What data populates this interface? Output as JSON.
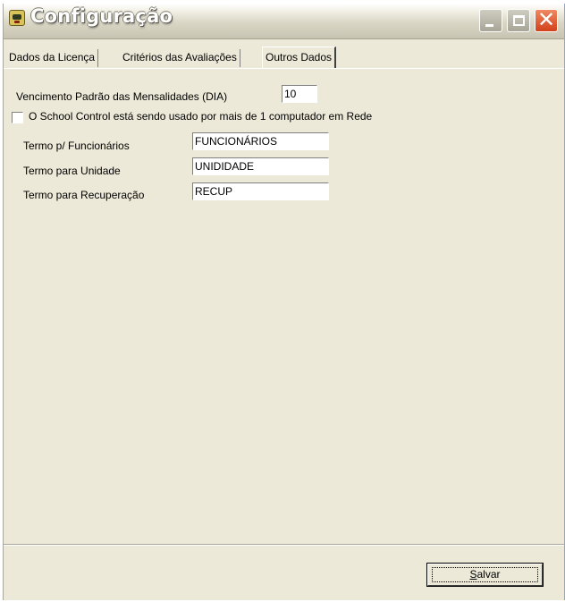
{
  "window": {
    "title": "Configuração",
    "icon": "app-icon",
    "controls": {
      "minimize": "minimize-icon",
      "maximize": "maximize-icon",
      "close": "close-icon",
      "close_glyph": "✕"
    }
  },
  "tabs": [
    {
      "label": "Dados da Licença"
    },
    {
      "label": "Critérios das Avaliações"
    },
    {
      "label": "Outros Dados"
    }
  ],
  "form": {
    "due_day_label": "Vencimento Padrão das Mensalidades (DIA)",
    "due_day_value": "10",
    "network_checkbox_label": "O School Control está sendo usado por mais de 1 computador em Rede",
    "network_checked": false,
    "terms": [
      {
        "label": "Termo p/ Funcionários",
        "value": "FUNCIONÁRIOS"
      },
      {
        "label": "Termo para Unidade",
        "value": "UNIDIDADE"
      },
      {
        "label": "Termo para Recuperação",
        "value": "RECUP"
      }
    ]
  },
  "footer": {
    "save_accel": "S",
    "save_rest": "alvar"
  },
  "colors": {
    "window_bg": "#ece9d8",
    "close_button": "#d1401a"
  }
}
